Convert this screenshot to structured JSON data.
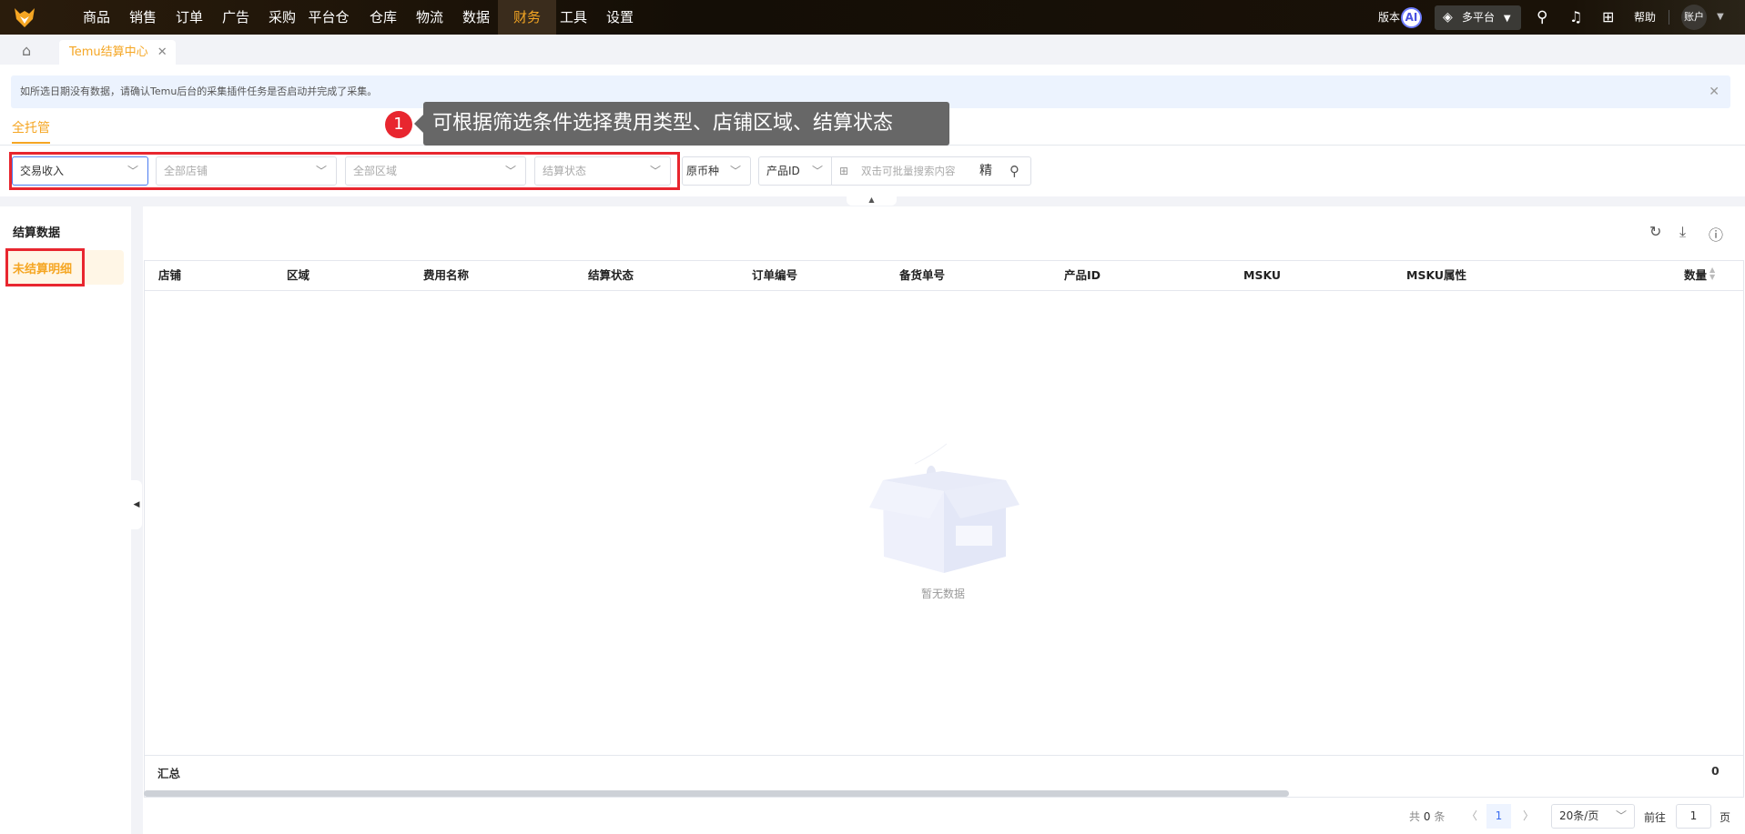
{
  "nav": {
    "items": [
      "商品",
      "销售",
      "订单",
      "广告",
      "采购",
      "平台仓",
      "仓库",
      "物流",
      "数据",
      "财务",
      "工具",
      "设置"
    ],
    "active": "财务",
    "right": {
      "version": "版本",
      "ai": "AI",
      "platform": "多平台",
      "help": "帮助",
      "account": "账户"
    }
  },
  "tabs": {
    "open_tab": "Temu结算中心"
  },
  "notice": "如所选日期没有数据，请确认Temu后台的采集插件任务是否启动并完成了采集。",
  "tooltip": {
    "step": "1",
    "text": "可根据筛选条件选择费用类型、店铺区域、结算状态"
  },
  "subtab": "全托管",
  "filters": {
    "fee_type": "交易收入",
    "shop_placeholder": "全部店铺",
    "region_placeholder": "全部区域",
    "status_placeholder": "结算状态",
    "currency": "原币种",
    "search_field": "产品ID",
    "search_placeholder": "双击可批量搜索内容",
    "precise": "精"
  },
  "sidebar": {
    "items": [
      "结算数据",
      "未结算明细"
    ],
    "active": "未结算明细"
  },
  "table": {
    "columns": [
      "店铺",
      "区域",
      "费用名称",
      "结算状态",
      "订单编号",
      "备货单号",
      "产品ID",
      "MSKU",
      "MSKU属性",
      "数量"
    ],
    "empty_text": "暂无数据",
    "summary_label": "汇总",
    "summary_qty": "0"
  },
  "pagination": {
    "total_prefix": "共",
    "total": "0",
    "total_suffix": "条",
    "current_page": "1",
    "page_size": "20条/页",
    "goto_label": "前往",
    "goto_value": "1",
    "page_suffix": "页"
  },
  "colors": {
    "accent": "#f5a623",
    "highlight": "#e8262f"
  }
}
